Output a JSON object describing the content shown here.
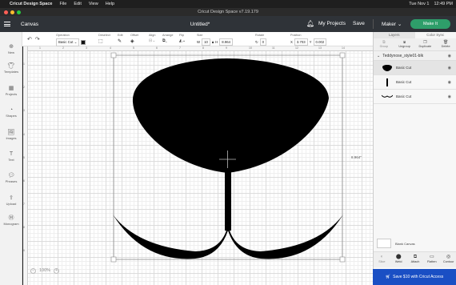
{
  "menubar": {
    "apple_glyph": "",
    "items": [
      "Cricut Design Space",
      "File",
      "Edit",
      "View",
      "Help"
    ],
    "right_date": "Tue Nov 1",
    "right_time": "12:49 PM"
  },
  "window": {
    "title": "Cricut Design Space  v7.19.179"
  },
  "header": {
    "canvas_label": "Canvas",
    "doc_title": "Untitled*",
    "my_projects": "My Projects",
    "save": "Save",
    "maker": "Maker",
    "make_it": "Make It"
  },
  "toolbar": {
    "undo": "↶",
    "redo": "↷",
    "operation_label": "Operation",
    "operation_value": "Basic Cut",
    "deselect": "Deselect",
    "edit": "Edit",
    "offset": "Offset",
    "align": "Align",
    "arrange": "Arrange",
    "flip": "Flip",
    "size": "Size",
    "w_label": "W",
    "w_value": "10",
    "h_label": "H",
    "h_value": "8.964",
    "rotate": "Rotate",
    "rotate_value": "0",
    "position": "Position",
    "x_label": "X",
    "x_value": "3.703",
    "y_label": "Y",
    "y_value": "0.002",
    "operation_color": "#111111"
  },
  "sidebar": {
    "items": [
      {
        "label": "New",
        "icon": "plus-icon"
      },
      {
        "label": "Templates",
        "icon": "shirt-icon"
      },
      {
        "label": "Projects",
        "icon": "projects-icon"
      },
      {
        "label": "Shapes",
        "icon": "shapes-icon"
      },
      {
        "label": "Images",
        "icon": "image-icon"
      },
      {
        "label": "Text",
        "icon": "text-icon"
      },
      {
        "label": "Phrases",
        "icon": "phrase-icon"
      },
      {
        "label": "Upload",
        "icon": "upload-icon"
      },
      {
        "label": "Monogram",
        "icon": "monogram-icon"
      }
    ]
  },
  "canvas": {
    "ruler_top": [
      "1",
      "2",
      "3",
      "4",
      "5",
      "6",
      "7",
      "8",
      "9",
      "10",
      "11",
      "12",
      "13",
      "14"
    ],
    "ruler_left": [
      "1",
      "2",
      "3",
      "4",
      "5",
      "6",
      "7",
      "8",
      "9",
      "10",
      "11",
      "12",
      "13"
    ],
    "height_label": "8.964\"",
    "zoom": "100%",
    "zoom_minus": "−",
    "zoom_plus": "+",
    "art_color": "#000000"
  },
  "right_panel": {
    "tabs": [
      "Layers",
      "Color Sync"
    ],
    "layer_tools": [
      "Group",
      "Ungroup",
      "Duplicate",
      "Delete"
    ],
    "group_name": "Teddynose_style01-blk",
    "layers": [
      {
        "label": "Basic Cut",
        "thumb": "nose"
      },
      {
        "label": "Basic Cut",
        "thumb": "line"
      },
      {
        "label": "Basic Cut",
        "thumb": "mouth"
      }
    ],
    "blank_canvas": "Blank Canvas",
    "bottom_tools": [
      "Slice",
      "Weld",
      "Attach",
      "Flatten",
      "Contour"
    ],
    "promo": "Save $10 with Cricut Access"
  }
}
